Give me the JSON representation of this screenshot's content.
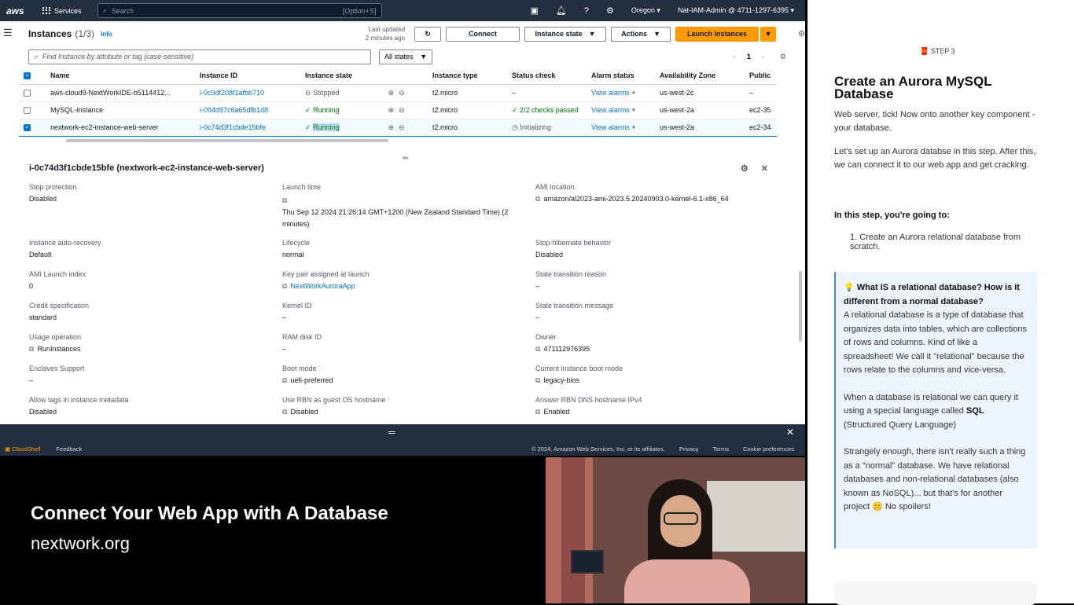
{
  "topnav": {
    "logo": "aws",
    "services": "Services",
    "search_placeholder": "Search",
    "search_kbd": "[Option+S]",
    "region": "Oregon ▾",
    "account": "Nat-IAM-Admin @ 4711-1297-6395 ▾"
  },
  "header": {
    "title": "Instances",
    "count": "(1/3)",
    "info": "Info",
    "last_updated_1": "Last updated",
    "last_updated_2": "2 minutes ago",
    "connect": "Connect",
    "instance_state": "Instance state",
    "actions": "Actions",
    "launch": "Launch instances"
  },
  "filter": {
    "placeholder": "Find Instance by attribute or tag (case-sensitive)",
    "states": "All states",
    "page": "1"
  },
  "table": {
    "columns": [
      "Name",
      "Instance ID",
      "Instance state",
      "Instance type",
      "Status check",
      "Alarm status",
      "Availability Zone",
      "Public"
    ],
    "rows": [
      {
        "name": "aws-cloud9-NextWorkIDE-b5114412...",
        "id": "i-0c9df208f1afbb710",
        "state": "Stopped",
        "type": "t2.micro",
        "status": "–",
        "alarm": "View alarms",
        "az": "us-west-2c",
        "public": "–"
      },
      {
        "name": "MySQL-Instance",
        "id": "i-094d97c6a65dfb1d8",
        "state": "Running",
        "type": "t2.micro",
        "status": "2/2 checks passed",
        "alarm": "View alarms",
        "az": "us-west-2a",
        "public": "ec2-35"
      },
      {
        "name": "nextwork-ec2-instance-web-server",
        "id": "i-0c74d3f1cbde15bfe",
        "state": "Running",
        "type": "t2.micro",
        "status": "Initializing",
        "alarm": "View alarms",
        "az": "us-west-2a",
        "public": "ec2-34"
      }
    ]
  },
  "details": {
    "title": "i-0c74d3f1cbde15bfe (nextwork-ec2-instance-web-server)",
    "c1": [
      [
        "Stop protection",
        "Disabled"
      ],
      [
        "Instance auto-recovery",
        "Default"
      ],
      [
        "AMI Launch index",
        "0"
      ],
      [
        "Credit specification",
        "standard"
      ],
      [
        "Usage operation",
        "RunInstances"
      ],
      [
        "Enclaves Support",
        "–"
      ],
      [
        "Allow tags in instance metadata",
        "Disabled"
      ]
    ],
    "c2": [
      [
        "Launch time",
        "Thu Sep 12 2024 21:26:14 GMT+1200 (New Zealand Standard Time) (2 minutes)"
      ],
      [
        "Lifecycle",
        "normal"
      ],
      [
        "Key pair assigned at launch",
        "NextWorkAuroraApp"
      ],
      [
        "Kernel ID",
        "–"
      ],
      [
        "RAM disk ID",
        "–"
      ],
      [
        "Boot mode",
        "uefi-preferred"
      ],
      [
        "Use RBN as guest OS hostname",
        "Disabled"
      ]
    ],
    "c3": [
      [
        "AMI location",
        "amazon/al2023-ami-2023.5.20240903.0-kernel-6.1-x86_64"
      ],
      [
        "Stop-hibernate behavior",
        "Disabled"
      ],
      [
        "State transition reason",
        "–"
      ],
      [
        "State transition message",
        "–"
      ],
      [
        "Owner",
        "471112976395"
      ],
      [
        "Current instance boot mode",
        "legacy-bios"
      ],
      [
        "Answer RBN DNS hostname IPv4",
        "Enabled"
      ]
    ]
  },
  "footer": {
    "cloudshell": "CloudShell",
    "feedback": "Feedback",
    "copyright": "© 2024, Amazon Web Services, Inc. or its affiliates.",
    "privacy": "Privacy",
    "terms": "Terms",
    "cookies": "Cookie preferences"
  },
  "overlay": {
    "title": "Connect Your Web App with A Database",
    "site": "nextwork.org"
  },
  "panel": {
    "step": "🧧 STEP 3",
    "title": "Create an Aurora MySQL Database",
    "p1": "Web server, tick! Now onto another key component - your database.",
    "p2": "Let's set up an Aurora databse in this step. After this, we can connect it to our web app and get cracking.",
    "h3": "In this step, you're going to:",
    "li1": "Create an Aurora relational database from scratch.",
    "callout_title": "💡 What IS a relational database? How is it different from a normal database?",
    "callout_p1": "A relational database is a type of database that organizes data into tables, which are collections of rows and columns. Kind of like a spreadsheet! We call it \"relational\" because the rows relate to the columns and vice-versa.",
    "callout_p2a": "When a database is relational we can query it using a special language called ",
    "callout_sql": "SQL",
    "callout_p2b": " (Structured Query Language)",
    "callout_p3": "Strangely enough, there isn't really such a thing as a \"normal\" database. We have relational databases and non-relational databases (also known as NoSQL)... but that's for another project 🤫 No spoilers!"
  }
}
